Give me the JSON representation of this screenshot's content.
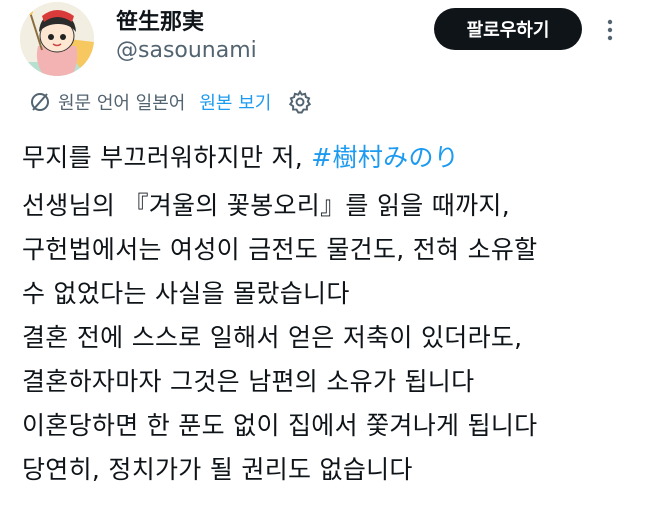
{
  "author": {
    "display_name": "笹生那実",
    "handle": "@sasounami"
  },
  "follow_button": "팔로우하기",
  "icons": {
    "avatar": "avatar-illustration",
    "more": "more-vertical-icon",
    "translate": "translate-icon",
    "settings": "gear-icon"
  },
  "translation": {
    "original_language": "원문 언어 일본어",
    "view_original": "원본 보기"
  },
  "post": {
    "first_line_text": "무지를 부끄러워하지만 저, ",
    "hashtag": "#樹村みのり",
    "lines": [
      "선생님의 『겨울의 꽃봉오리』를 읽을 때까지,",
      "구헌법에서는 여성이 금전도 물건도, 전혀 소유할",
      "수 없었다는 사실을 몰랐습니다",
      "결혼 전에 스스로 일해서 얻은 저축이 있더라도,",
      "결혼하자마자 그것은 남편의 소유가 됩니다",
      "이혼당하면 한 푼도 없이 집에서 쫓겨나게 됩니다",
      "당연히, 정치가가 될 권리도 없습니다"
    ]
  },
  "colors": {
    "text": "#0f1419",
    "secondary": "#536471",
    "link": "#1d9bf0",
    "button_bg": "#0f1419"
  }
}
